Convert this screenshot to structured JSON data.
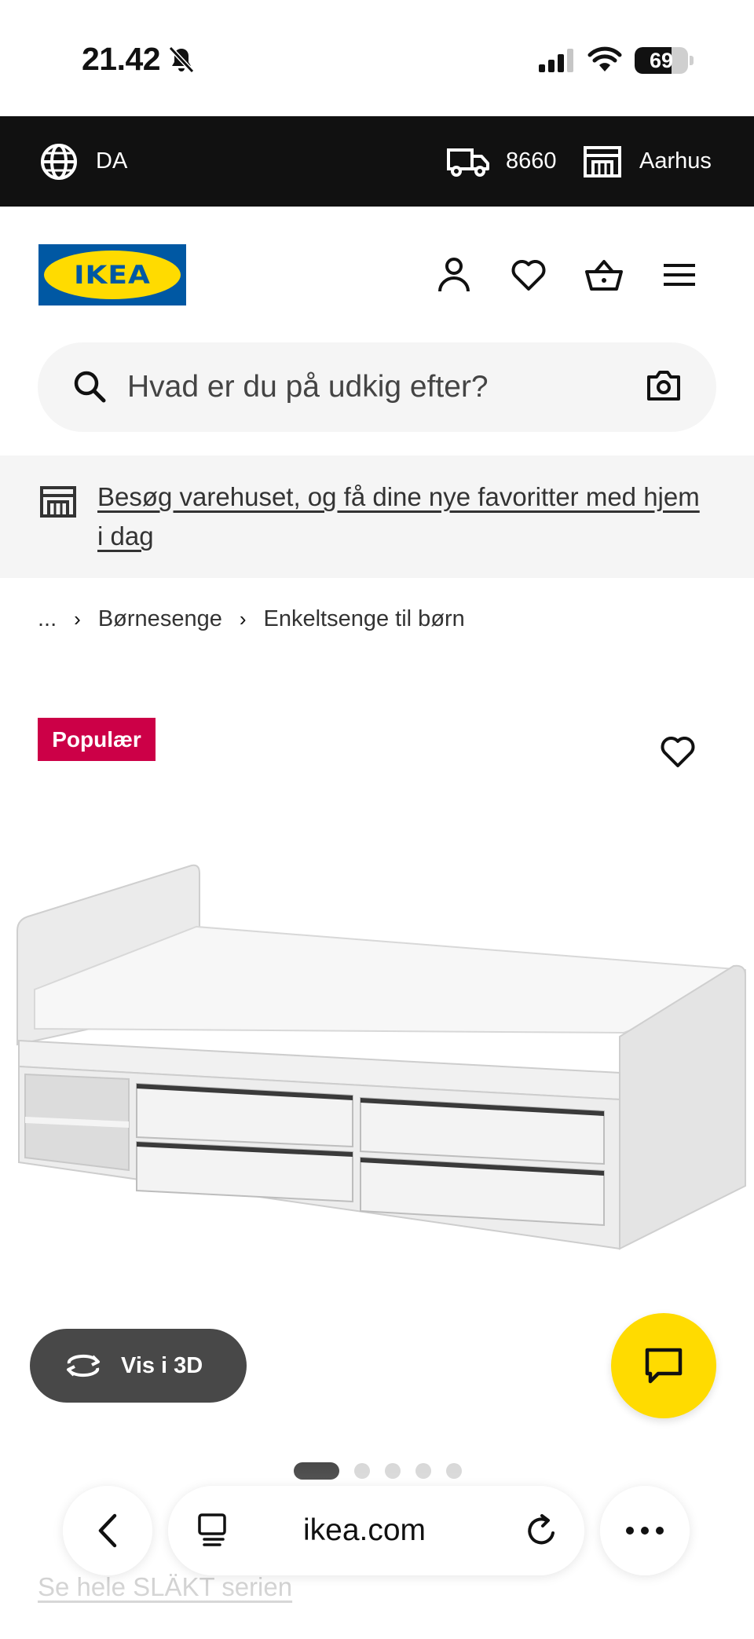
{
  "status_bar": {
    "time": "21.42",
    "battery_level": "69",
    "battery_fraction": 0.69,
    "icons": [
      "bell-muted-icon",
      "cellular-signal-icon",
      "wifi-icon",
      "battery-icon"
    ]
  },
  "location_bar": {
    "language": "DA",
    "postal_code": "8660",
    "store": "Aarhus",
    "icons": [
      "globe-icon",
      "delivery-truck-icon",
      "store-icon"
    ]
  },
  "header": {
    "logo_text": "IKEA",
    "icons": [
      "account-icon",
      "heart-icon",
      "basket-icon",
      "hamburger-menu-icon"
    ]
  },
  "search": {
    "placeholder": "Hvad er du på udkig efter?",
    "icons": [
      "search-icon",
      "camera-icon"
    ]
  },
  "store_banner": {
    "text": "Besøg varehuset, og få dine nye favoritter med hjem i dag"
  },
  "breadcrumb": {
    "ellipsis": "...",
    "separator": "›",
    "items": [
      "Børnesenge",
      "Enkeltsenge til børn"
    ]
  },
  "product": {
    "badge": "Populær",
    "view_3d_label": "Vis i 3D",
    "image_count": 5,
    "active_image": 1
  },
  "series_link": "Se hele SLÄKT serien",
  "browser": {
    "url": "ikea.com",
    "icons": [
      "back-icon",
      "tabs-icon",
      "reload-icon",
      "more-icon"
    ]
  },
  "colors": {
    "ikea_blue": "#0058a3",
    "ikea_yellow": "#ffdb00",
    "badge_red": "#cc0047",
    "dark_bar": "#111111"
  }
}
